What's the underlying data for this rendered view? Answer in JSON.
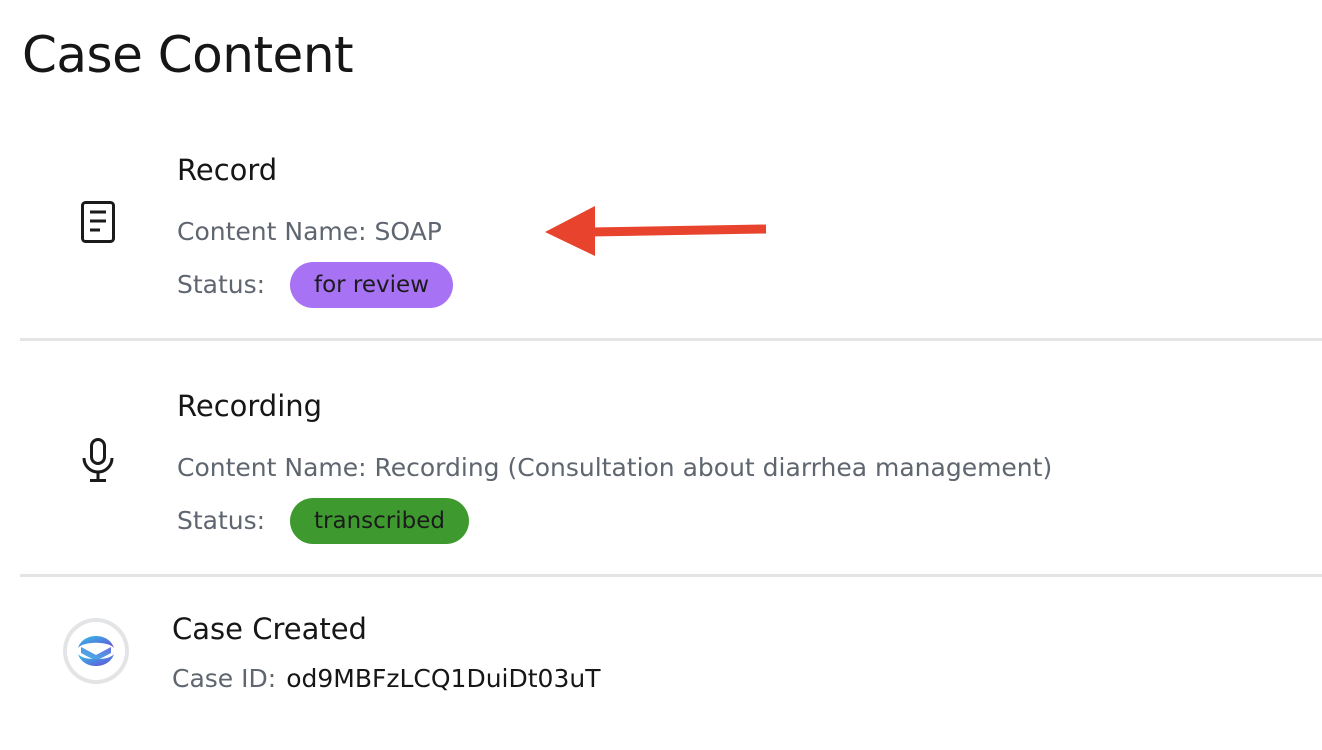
{
  "page": {
    "title": "Case Content"
  },
  "entries": [
    {
      "title": "Record",
      "icon": "document-icon",
      "content_name": "Content Name: SOAP",
      "status_label": "Status:",
      "status": "for review",
      "status_color": "#a872f5"
    },
    {
      "title": "Recording",
      "icon": "microphone-icon",
      "content_name": "Content Name: Recording (Consultation about diarrhea management)",
      "status_label": "Status:",
      "status": "transcribed",
      "status_color": "#3e9a2f"
    }
  ],
  "case": {
    "title": "Case Created",
    "icon": "app-logo-icon",
    "id_label": "Case ID:",
    "id_value": "od9MBFzLCQ1DuiDt03uT"
  },
  "annotation": {
    "arrow_color": "#e8432c"
  }
}
